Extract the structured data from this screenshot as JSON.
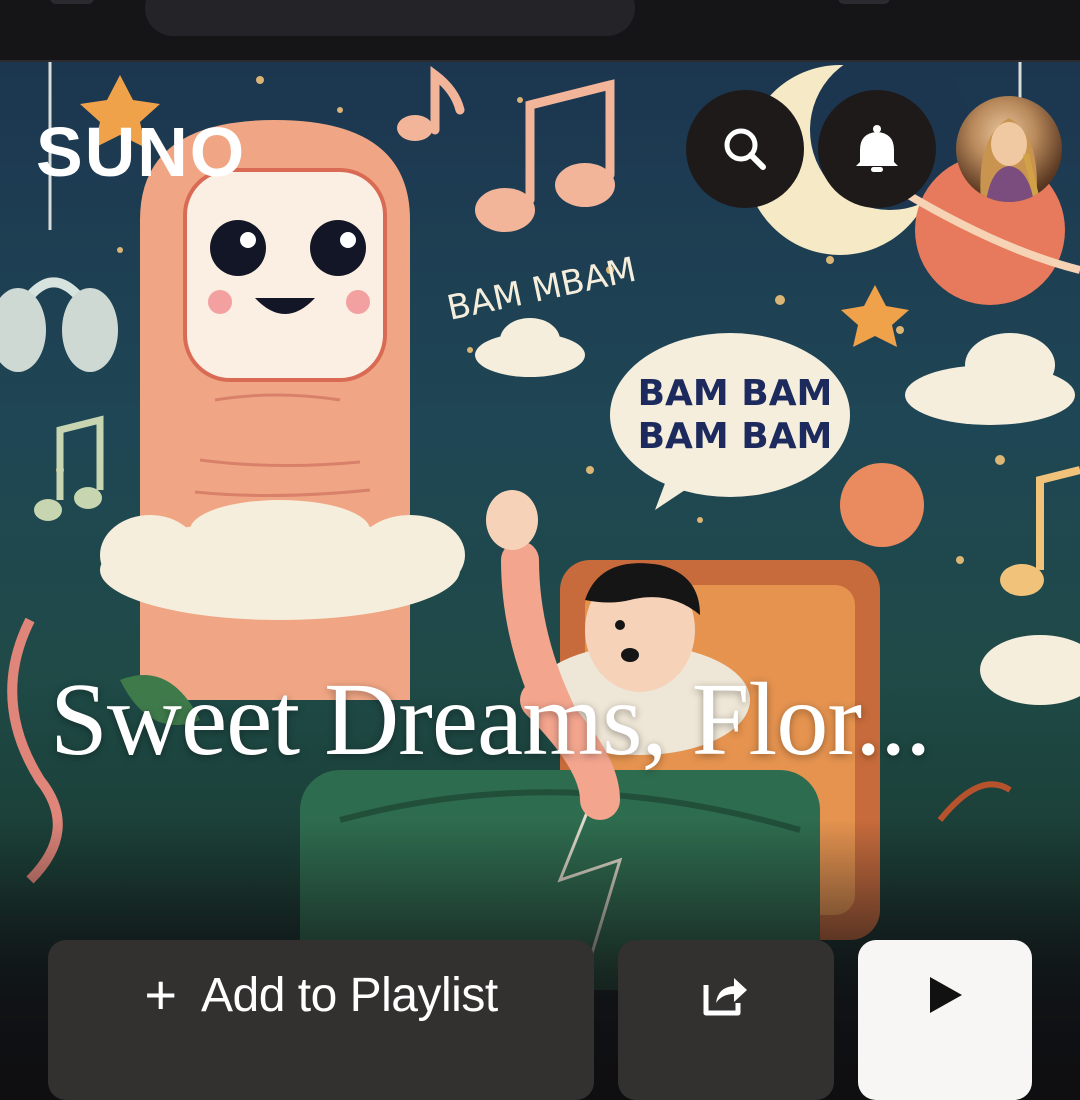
{
  "app": {
    "logo": "SUNO"
  },
  "header": {
    "search_icon": "search-icon",
    "notifications_icon": "bell-icon",
    "avatar": "user-avatar"
  },
  "hero": {
    "title": "Sweet Dreams, Flor...",
    "art_text": [
      "BAM MBAM",
      "BAM BAM",
      "BAM BAM"
    ]
  },
  "actions": {
    "add_to_playlist_label": "Add to Playlist",
    "add_icon": "plus-icon",
    "share_icon": "share-icon",
    "play_icon": "play-icon"
  },
  "colors": {
    "button_dark": "#333030",
    "button_light": "#f8f6f4",
    "icon_button_bg": "#1e1a1a"
  }
}
